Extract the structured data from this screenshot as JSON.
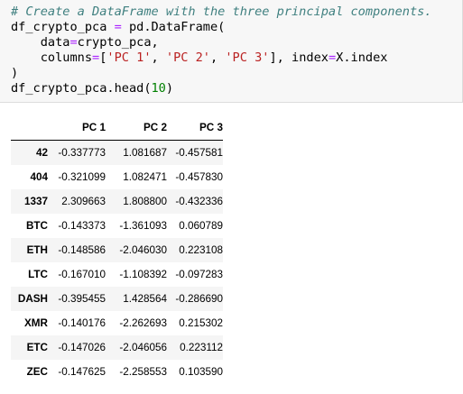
{
  "code": {
    "comment": "# Create a DataFrame with the three principal components.",
    "line2_var": "df_crypto_pca ",
    "line2_eq": "=",
    "line2_rest": " pd.DataFrame(",
    "line3_a": "    data",
    "line3_eq": "=",
    "line3_b": "crypto_pca,",
    "line4_a": "    columns",
    "line4_eq": "=",
    "line4_b": "[",
    "line4_s1": "'PC 1'",
    "line4_c1": ", ",
    "line4_s2": "'PC 2'",
    "line4_c2": ", ",
    "line4_s3": "'PC 3'",
    "line4_c3": "], index",
    "line4_eq2": "=",
    "line4_c4": "X.index",
    "line5": ")",
    "line6_a": "df_crypto_pca.head(",
    "line6_num": "10",
    "line6_b": ")"
  },
  "table": {
    "columns": [
      "PC 1",
      "PC 2",
      "PC 3"
    ],
    "rows": [
      {
        "index": "42",
        "values": [
          "-0.337773",
          "1.081687",
          "-0.457581"
        ]
      },
      {
        "index": "404",
        "values": [
          "-0.321099",
          "1.082471",
          "-0.457830"
        ]
      },
      {
        "index": "1337",
        "values": [
          "2.309663",
          "1.808800",
          "-0.432336"
        ]
      },
      {
        "index": "BTC",
        "values": [
          "-0.143373",
          "-1.361093",
          "0.060789"
        ]
      },
      {
        "index": "ETH",
        "values": [
          "-0.148586",
          "-2.046030",
          "0.223108"
        ]
      },
      {
        "index": "LTC",
        "values": [
          "-0.167010",
          "-1.108392",
          "-0.097283"
        ]
      },
      {
        "index": "DASH",
        "values": [
          "-0.395455",
          "1.428564",
          "-0.286690"
        ]
      },
      {
        "index": "XMR",
        "values": [
          "-0.140176",
          "-2.262693",
          "0.215302"
        ]
      },
      {
        "index": "ETC",
        "values": [
          "-0.147026",
          "-2.046056",
          "0.223112"
        ]
      },
      {
        "index": "ZEC",
        "values": [
          "-0.147625",
          "-2.258553",
          "0.103590"
        ]
      }
    ]
  }
}
